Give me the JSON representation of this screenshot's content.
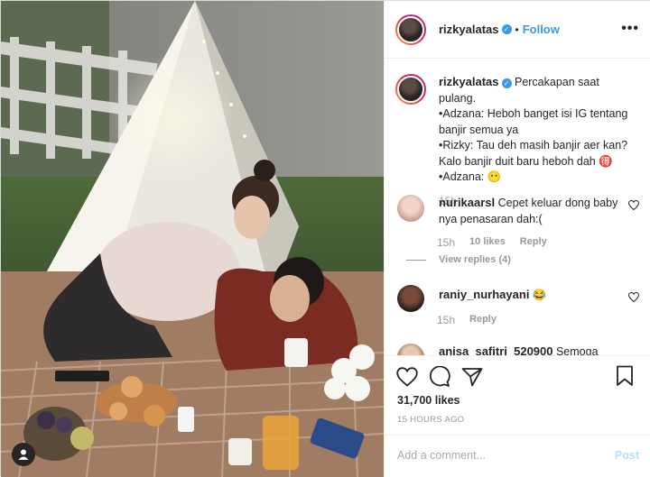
{
  "post": {
    "username": "rizkyalatas",
    "follow_label": "Follow",
    "separator": "•",
    "more_label": "•••"
  },
  "caption": {
    "username": "rizkyalatas",
    "lines": [
      "Percakapan saat pulang.",
      "•Adzana: Heboh banget isi IG tentang banjir semua ya",
      "•Rizky: Tau deh masih banjir aer kan? Kalo banjir duit baru heboh dah 🉐",
      "•Adzana: 😶"
    ],
    "time": "15h"
  },
  "comments": [
    {
      "username": "nurikaarsl",
      "text": "Cepet keluar dong baby nya penasaran dah:(",
      "time": "15h",
      "likes": "10 likes",
      "reply_label": "Reply",
      "view_replies": "View replies (4)"
    },
    {
      "username": "raniy_nurhayani",
      "text": "😂",
      "time": "15h",
      "reply_label": "Reply"
    },
    {
      "username": "anisa_safitri_520900",
      "text": "Semoga"
    }
  ],
  "stats": {
    "likes": "31,700 likes",
    "time_ago": "15 HOURS AGO"
  },
  "add_comment": {
    "placeholder": "Add a comment...",
    "post_label": "Post"
  },
  "colors": {
    "accent": "#3897f0",
    "post_disabled": "#b2dffc",
    "muted": "#999999"
  }
}
